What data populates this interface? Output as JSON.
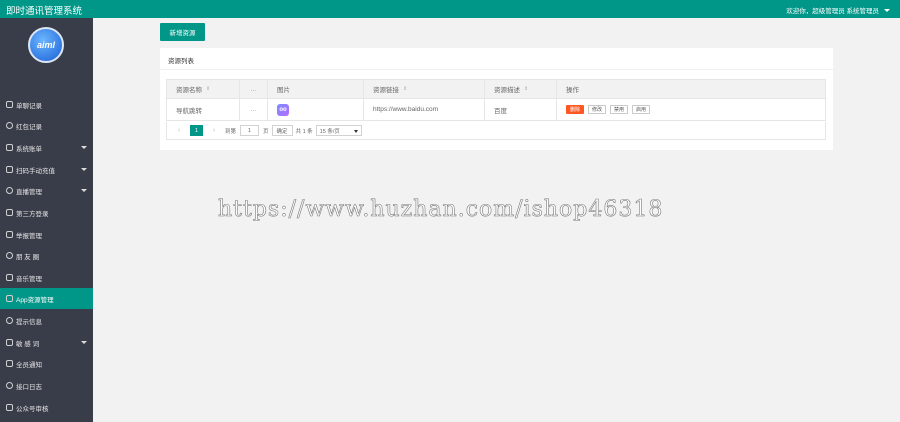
{
  "app": {
    "title": "即时通讯管理系统",
    "user_text": "欢迎你，超级管理员 系统管理员"
  },
  "sidebar": {
    "logo_text": "aiml",
    "items": [
      {
        "label": "单聊记录",
        "icon": "chat-icon",
        "dropdown": false,
        "active": false
      },
      {
        "label": "红包记录",
        "icon": "red-packet-icon",
        "dropdown": false,
        "active": false
      },
      {
        "label": "系统账单",
        "icon": "bill-icon",
        "dropdown": true,
        "active": false
      },
      {
        "label": "扫码手动充值",
        "icon": "scan-icon",
        "dropdown": true,
        "active": false
      },
      {
        "label": "直播管理",
        "icon": "live-icon",
        "dropdown": true,
        "active": false
      },
      {
        "label": "第三方登录",
        "icon": "login-icon",
        "dropdown": false,
        "active": false
      },
      {
        "label": "举报管理",
        "icon": "report-icon",
        "dropdown": false,
        "active": false
      },
      {
        "label": "朋 友 圈",
        "icon": "moments-icon",
        "dropdown": false,
        "active": false
      },
      {
        "label": "音乐管理",
        "icon": "music-icon",
        "dropdown": false,
        "active": false
      },
      {
        "label": "App资源管理",
        "icon": "app-resource-icon",
        "dropdown": false,
        "active": true
      },
      {
        "label": "提示信息",
        "icon": "info-icon",
        "dropdown": false,
        "active": false
      },
      {
        "label": "敏 感 词",
        "icon": "tag-icon",
        "dropdown": true,
        "active": false
      },
      {
        "label": "全员通知",
        "icon": "notify-icon",
        "dropdown": false,
        "active": false
      },
      {
        "label": "接口日志",
        "icon": "log-icon",
        "dropdown": false,
        "active": false
      },
      {
        "label": "公众号审核",
        "icon": "audit-icon",
        "dropdown": false,
        "active": false
      }
    ]
  },
  "toolbar": {
    "add_label": "新增资源"
  },
  "list": {
    "title": "资源列表",
    "headers": [
      "资源名称",
      "...",
      "图片",
      "资源链接",
      "资源描述",
      "操作"
    ],
    "rows": [
      {
        "name": "导航跳转",
        "more": "...",
        "image_text": "oo",
        "url": "https://www.baidu.com",
        "desc": "百度",
        "ops": [
          "删除",
          "修改",
          "禁用",
          "启用"
        ]
      }
    ]
  },
  "pager": {
    "prev": "‹",
    "next": "›",
    "current": "1",
    "goto_label": "到第",
    "goto_value": "1",
    "page_unit": "页",
    "confirm": "确定",
    "total": "共 1 条",
    "page_size": "15 条/页"
  },
  "watermark": "https://www.huzhan.com/ishop46318",
  "colors": {
    "primary": "#009688",
    "sidebar": "#393d49",
    "danger": "#ff5722"
  }
}
